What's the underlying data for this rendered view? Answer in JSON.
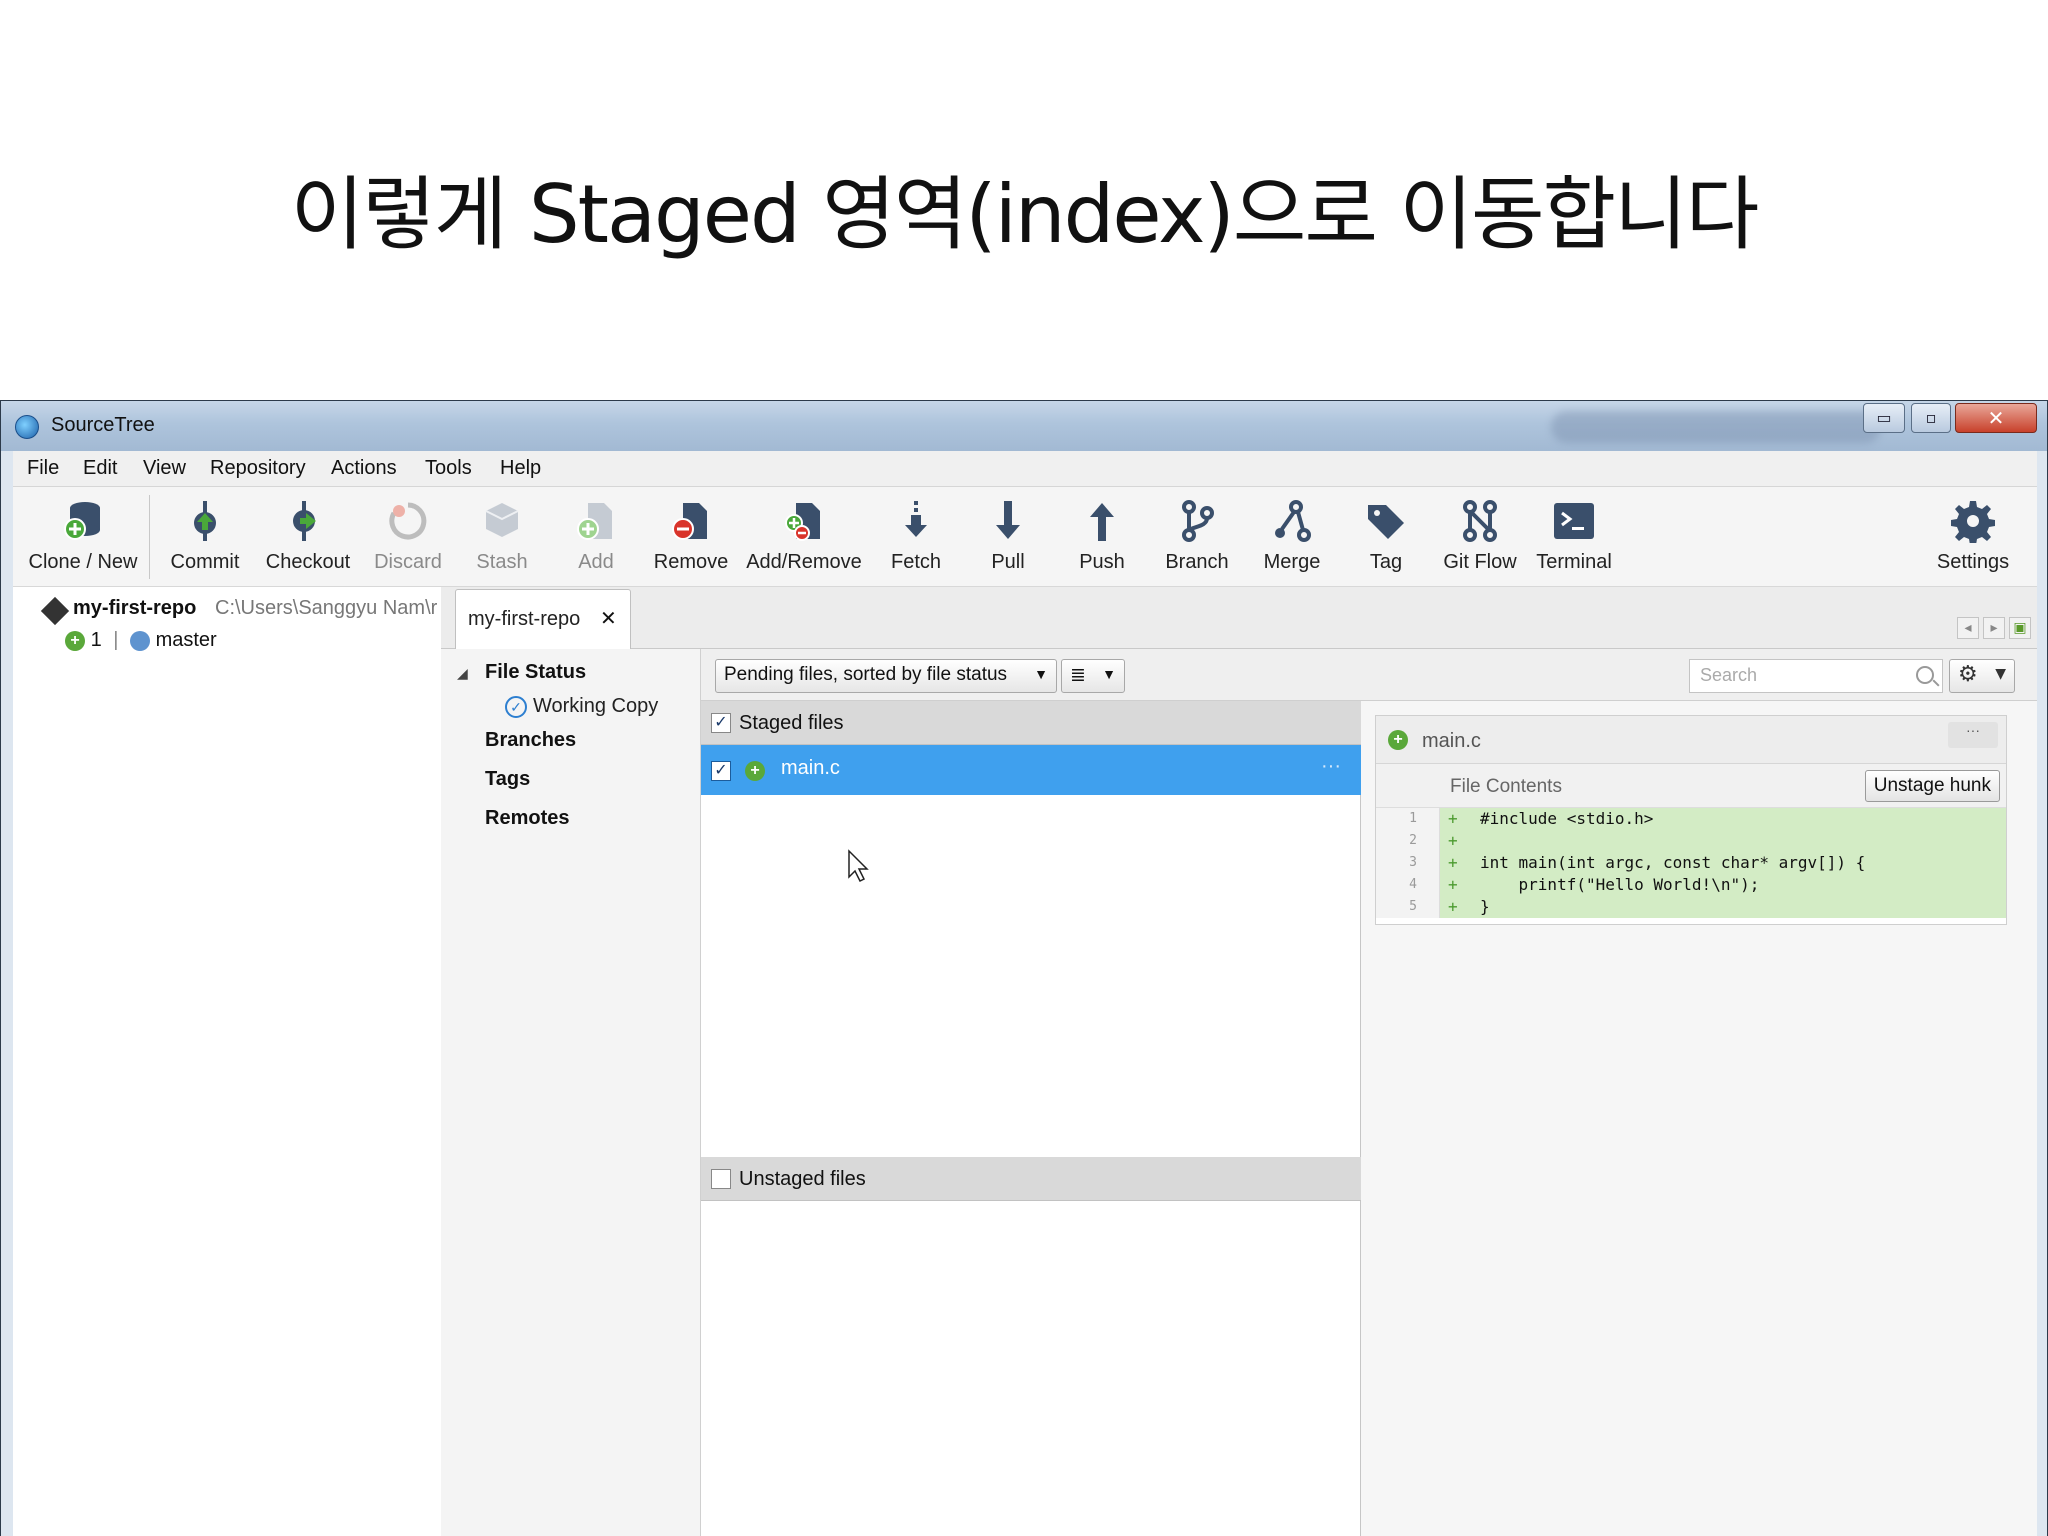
{
  "slide": {
    "title": "이렇게 Staged 영역(index)으로 이동합니다"
  },
  "window": {
    "title": "SourceTree",
    "min_label": "▭",
    "max_label": "▫",
    "close_label": "✕"
  },
  "menu": [
    "File",
    "Edit",
    "View",
    "Repository",
    "Actions",
    "Tools",
    "Help"
  ],
  "toolbar": {
    "clone_new": "Clone / New",
    "commit": "Commit",
    "checkout": "Checkout",
    "discard": "Discard",
    "stash": "Stash",
    "add": "Add",
    "remove": "Remove",
    "add_remove": "Add/Remove",
    "fetch": "Fetch",
    "pull": "Pull",
    "push": "Push",
    "branch": "Branch",
    "merge": "Merge",
    "tag": "Tag",
    "git_flow": "Git Flow",
    "terminal": "Terminal",
    "settings": "Settings"
  },
  "repo": {
    "name": "my-first-repo",
    "path": "C:\\Users\\Sanggyu Nam\\r",
    "ahead_count": "1",
    "separator": "|",
    "branch": "master"
  },
  "tab": {
    "label": "my-first-repo",
    "close": "✕"
  },
  "nav": {
    "file_status": "File Status",
    "working_copy": "Working Copy",
    "branches": "Branches",
    "tags": "Tags",
    "remotes": "Remotes"
  },
  "filter": {
    "view_mode": "Pending files, sorted by file status",
    "list_icon": "≣",
    "search_placeholder": "Search",
    "gear": "⚙"
  },
  "staged": {
    "header": "Staged files",
    "checked": "✓",
    "files": [
      {
        "name": "main.c",
        "checked": "✓",
        "dots": "···"
      }
    ]
  },
  "unstaged": {
    "header": "Unstaged files"
  },
  "diff": {
    "file": "main.c",
    "more": "···",
    "hunk_label": "File Contents",
    "unstage_hunk": "Unstage hunk",
    "lines": [
      {
        "n": "1",
        "sign": "+",
        "text": "#include <stdio.h>"
      },
      {
        "n": "2",
        "sign": "+",
        "text": ""
      },
      {
        "n": "3",
        "sign": "+",
        "text": "int main(int argc, const char* argv[]) {"
      },
      {
        "n": "4",
        "sign": "+",
        "text": "    printf(\"Hello World!\\n\");"
      },
      {
        "n": "5",
        "sign": "+",
        "text": "}"
      }
    ]
  },
  "colors": {
    "selection": "#3fa0ee",
    "added_line": "#d3ecc5",
    "add_green": "#5aa83a",
    "remove_red": "#d9342b"
  }
}
